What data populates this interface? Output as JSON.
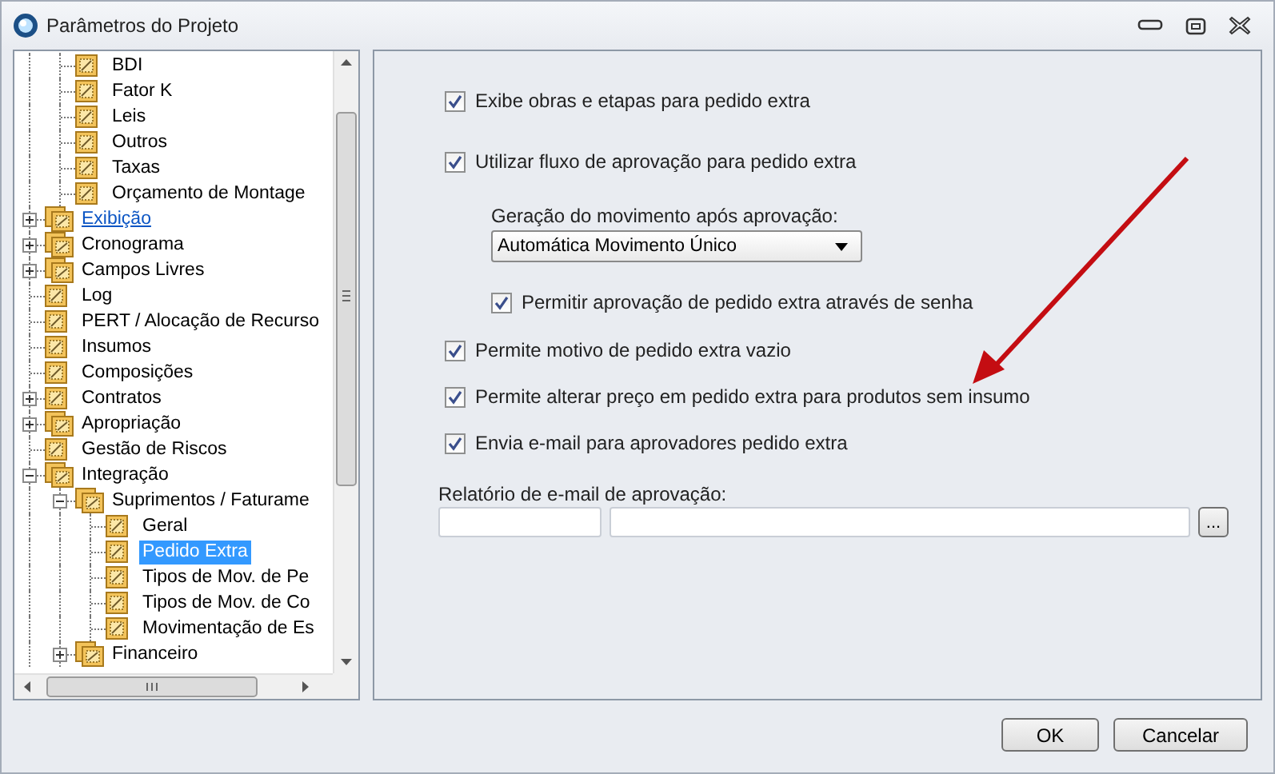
{
  "window": {
    "title": "Parâmetros do Projeto"
  },
  "tree": {
    "items": [
      {
        "children": [
          {
            "label": "BDI",
            "kind": "page",
            "selected": false,
            "hovered": false
          },
          {
            "label": "Fator K",
            "kind": "page",
            "selected": false,
            "hovered": false
          },
          {
            "label": "Leis",
            "kind": "page",
            "selected": false,
            "hovered": false
          },
          {
            "label": "Outros",
            "kind": "page",
            "selected": false,
            "hovered": false
          },
          {
            "label": "Taxas",
            "kind": "page",
            "selected": false,
            "hovered": false
          },
          {
            "label": "Orçamento de Montage",
            "kind": "page",
            "selected": false,
            "hovered": false
          }
        ]
      },
      {
        "label": "Exibição",
        "kind": "group",
        "expanded": false,
        "selected": false,
        "hovered": true
      },
      {
        "label": "Cronograma",
        "kind": "group",
        "expanded": false,
        "selected": false,
        "hovered": false
      },
      {
        "label": "Campos Livres",
        "kind": "group",
        "expanded": false,
        "selected": false,
        "hovered": false
      },
      {
        "label": "Log",
        "kind": "page",
        "selected": false,
        "hovered": false
      },
      {
        "label": "PERT / Alocação de Recurso",
        "kind": "page",
        "selected": false,
        "hovered": false
      },
      {
        "label": "Insumos",
        "kind": "page",
        "selected": false,
        "hovered": false
      },
      {
        "label": "Composições",
        "kind": "page",
        "selected": false,
        "hovered": false
      },
      {
        "label": "Contratos",
        "kind": "page",
        "expanded": false,
        "selected": false,
        "hovered": false
      },
      {
        "label": "Apropriação",
        "kind": "group",
        "expanded": false,
        "selected": false,
        "hovered": false
      },
      {
        "label": "Gestão de Riscos",
        "kind": "page",
        "selected": false,
        "hovered": false
      },
      {
        "label": "Integração",
        "kind": "group",
        "expanded": true,
        "selected": false,
        "hovered": false,
        "children": [
          {
            "label": "Suprimentos / Faturame",
            "kind": "group",
            "expanded": true,
            "selected": false,
            "hovered": false,
            "children": [
              {
                "label": "Geral",
                "kind": "page",
                "selected": false,
                "hovered": false
              },
              {
                "label": "Pedido Extra",
                "kind": "page",
                "selected": true,
                "hovered": false
              },
              {
                "label": "Tipos de Mov. de Pe",
                "kind": "page",
                "selected": false,
                "hovered": false
              },
              {
                "label": "Tipos de Mov. de Co",
                "kind": "page",
                "selected": false,
                "hovered": false
              },
              {
                "label": "Movimentação de Es",
                "kind": "page",
                "selected": false,
                "hovered": false
              }
            ]
          },
          {
            "label": "Financeiro",
            "kind": "group",
            "expanded": false,
            "selected": false,
            "hovered": false
          }
        ]
      }
    ]
  },
  "settings": {
    "options": [
      {
        "kind": "checkbox",
        "label": "Exibe obras e etapas para pedido extra",
        "checked": true
      },
      {
        "kind": "checkbox",
        "label": "Utilizar fluxo de aprovação para pedido extra",
        "checked": true,
        "children": [
          {
            "kind": "dropdown",
            "label": "Geração do movimento após aprovação:",
            "value": "Automática Movimento Único"
          },
          {
            "kind": "checkbox",
            "label": "Permitir aprovação de pedido extra através de senha",
            "checked": true
          }
        ]
      },
      {
        "kind": "checkbox",
        "label": "Permite motivo de pedido extra vazio",
        "checked": true
      },
      {
        "kind": "checkbox",
        "label": "Permite alterar preço em pedido extra para produtos sem insumo",
        "checked": true
      },
      {
        "kind": "checkbox",
        "label": "Envia e-mail para aprovadores pedido extra",
        "checked": true
      }
    ],
    "report": {
      "label": "Relatório de e-mail de aprovação:",
      "button": "..."
    }
  },
  "buttons": [
    "OK",
    "Cancelar"
  ]
}
